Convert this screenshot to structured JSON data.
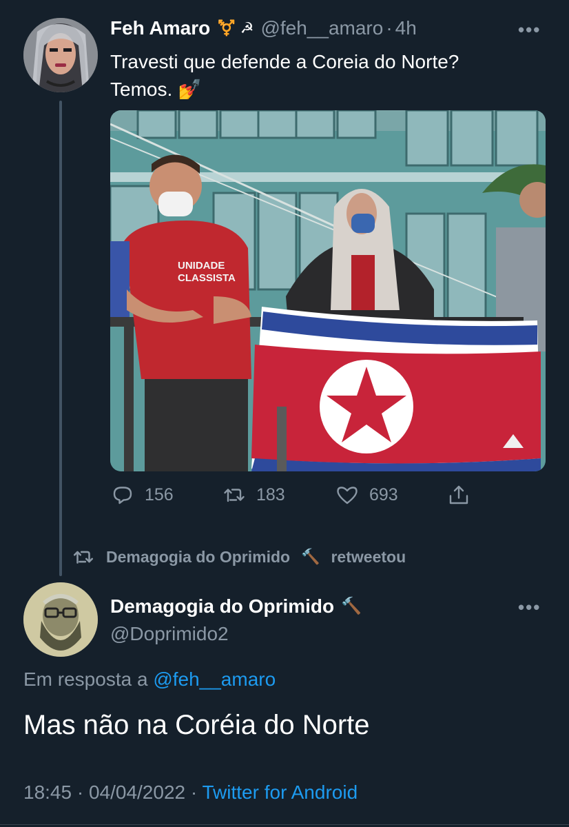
{
  "tweet": {
    "author_name": "Feh Amaro",
    "author_emoji": "⚧️ ☭",
    "handle": "@feh__amaro",
    "separator": "·",
    "time": "4h",
    "text_line1": "Travesti que defende a Coreia do Norte?",
    "text_line2": "Temos.",
    "text_emoji": "💅",
    "more": "•••",
    "actions": {
      "replies": "156",
      "retweets": "183",
      "likes": "693"
    }
  },
  "retweet_notice": {
    "name": "Demagogia do Oprimido",
    "emoji": "🔨",
    "suffix": "retweetou"
  },
  "reply": {
    "author_name": "Demagogia do Oprimido",
    "author_emoji": "🔨",
    "handle": "@Doprimido2",
    "more": "•••",
    "in_reply_prefix": "Em resposta a",
    "in_reply_handle": "@feh__amaro",
    "text": "Mas não na Coréia do Norte",
    "timestamp": "18:45 · 04/04/2022",
    "dot": "·",
    "client": "Twitter for Android"
  },
  "colors": {
    "background": "#15202b",
    "muted": "#8b98a5",
    "link": "#1d9bf0",
    "flag_red": "#c8243a",
    "flag_blue": "#2e4a9c"
  }
}
